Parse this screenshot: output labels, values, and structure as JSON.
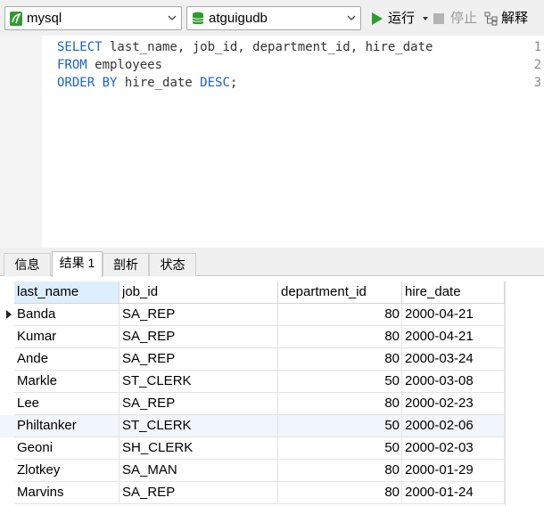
{
  "toolbar": {
    "connection": "mysql",
    "database": "atguigudb",
    "run_label": "运行",
    "stop_label": "停止",
    "explain_label": "解释"
  },
  "editor": {
    "lines": [
      {
        "number": "1",
        "tokens": [
          {
            "text": "SELECT",
            "kw": true
          },
          {
            "text": " last_name, job_id, department_id, hire_date",
            "kw": false
          }
        ]
      },
      {
        "number": "2",
        "tokens": [
          {
            "text": "FROM",
            "kw": true
          },
          {
            "text": " employees",
            "kw": false
          }
        ]
      },
      {
        "number": "3",
        "tokens": [
          {
            "text": "ORDER BY",
            "kw": true
          },
          {
            "text": " hire_date ",
            "kw": false
          },
          {
            "text": "DESC",
            "kw": true
          },
          {
            "text": ";",
            "kw": false
          }
        ]
      }
    ]
  },
  "tabs": [
    {
      "label": "信息",
      "active": false
    },
    {
      "label": "结果 1",
      "active": true
    },
    {
      "label": "剖析",
      "active": false
    },
    {
      "label": "状态",
      "active": false
    }
  ],
  "results": {
    "columns": [
      "last_name",
      "job_id",
      "department_id",
      "hire_date"
    ],
    "rows": [
      [
        "Banda",
        "SA_REP",
        "80",
        "2000-04-21"
      ],
      [
        "Kumar",
        "SA_REP",
        "80",
        "2000-04-21"
      ],
      [
        "Ande",
        "SA_REP",
        "80",
        "2000-03-24"
      ],
      [
        "Markle",
        "ST_CLERK",
        "50",
        "2000-03-08"
      ],
      [
        "Lee",
        "SA_REP",
        "80",
        "2000-02-23"
      ],
      [
        "Philtanker",
        "ST_CLERK",
        "50",
        "2000-02-06"
      ],
      [
        "Geoni",
        "SH_CLERK",
        "50",
        "2000-02-03"
      ],
      [
        "Zlotkey",
        "SA_MAN",
        "80",
        "2000-01-29"
      ],
      [
        "Marvins",
        "SA_REP",
        "80",
        "2000-01-24"
      ]
    ]
  },
  "colors": {
    "keyword": "#1b63c9",
    "run_icon": "#2e9b2e",
    "header_highlight": "#ddeeff",
    "alt_row": "#f0f6fc"
  }
}
